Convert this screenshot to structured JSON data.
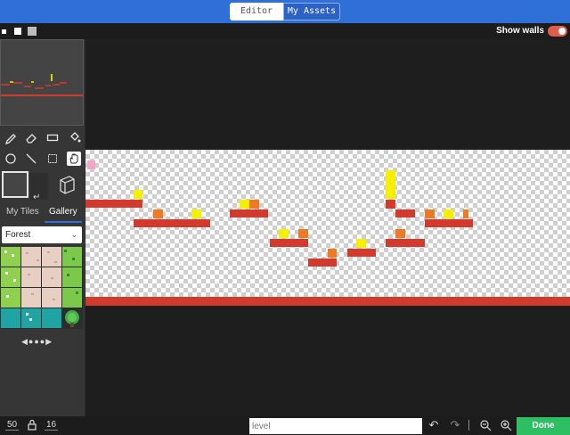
{
  "topbar": {
    "tabs": [
      {
        "label": "Editor",
        "active": false
      },
      {
        "label": "My Assets",
        "active": true
      }
    ],
    "accent_color": "#2f6fd8"
  },
  "subbar": {
    "show_walls_label": "Show walls",
    "show_walls_on": true,
    "toggle_color": "#e55b4b"
  },
  "tools": [
    "pencil-icon",
    "eraser-icon",
    "rectangle-icon",
    "fill-bucket-icon",
    "circle-icon",
    "line-icon",
    "select-icon",
    "hand-icon"
  ],
  "tile_tabs": {
    "my_tiles": "My Tiles",
    "gallery": "Gallery",
    "active": "Gallery"
  },
  "tileset_select": {
    "value": "Forest"
  },
  "bottombar": {
    "width": "50",
    "height": "16",
    "level_placeholder": "level",
    "done_label": "Done"
  },
  "colors": {
    "ground_red": "#d23a2e",
    "coin_yellow": "#f6ef00",
    "crate_orange": "#f07a24",
    "spawn_pink": "#f4a6c8",
    "done_green": "#2fbf63"
  }
}
